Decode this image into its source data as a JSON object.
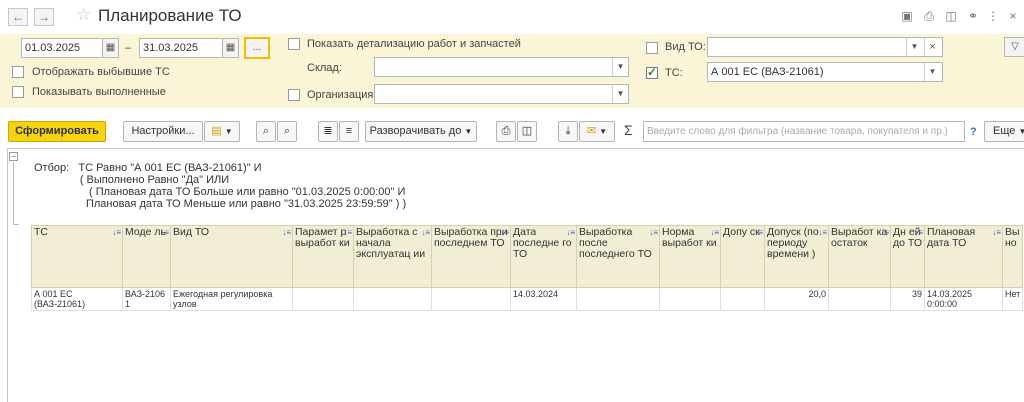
{
  "window": {
    "title": "Планирование ТО"
  },
  "filters": {
    "date_from": "01.03.2025",
    "date_sep": "–",
    "date_to": "31.03.2025",
    "period_button": "...",
    "show_retired_label": "Отображать выбывшие ТС",
    "show_completed_label": "Показывать выполненные",
    "show_details_label": "Показать детализацию работ и запчастей",
    "warehouse_label": "Склад:",
    "warehouse_value": "",
    "organization_label": "Организация:",
    "organization_value": "",
    "to_type_label": "Вид ТО:",
    "to_type_value": "",
    "clear_glyph": "×",
    "vehicle_label": "ТС:",
    "vehicle_value": "А 001 ЕС (ВАЗ-21061)"
  },
  "toolbar": {
    "generate": "Сформировать",
    "settings": "Настройки...",
    "expand_to": "Разворачивать до",
    "sigma": "Σ",
    "search_placeholder": "Введите слово для фильтра (название товара, покупателя и пр.)",
    "help": "?",
    "more": "Еще"
  },
  "report": {
    "filter_lines": [
      "Отбор:   ТС Равно \"А 001 ЕС (ВАЗ-21061)\" И",
      "               ( Выполнено Равно \"Да\" ИЛИ",
      "                  ( Плановая дата ТО Больше или равно \"01.03.2025 0:00:00\" И",
      "                 Плановая дата ТО Меньше или равно \"31.03.2025 23:59:59\" ) )"
    ],
    "columns": [
      "ТС",
      "Моде ль",
      "Вид ТО",
      "Парамет р выработ ки",
      "Выработка с начала эксплуатац ии",
      "Выработка при последнем ТО",
      "Дата последне го ТО",
      "Выработка после последнего ТО",
      "Норма выработ ки",
      "Допу ск",
      "Допуск (по периоду времени )",
      "Выработ ка остаток",
      "Дн ей до ТО",
      "Плановая дата ТО",
      "Вы но"
    ],
    "rows": [
      {
        "ts": "А 001 ЕС (ВАЗ-21061)",
        "model": "ВАЗ-2106 1",
        "to_type": "Ежегодная регулировка узлов",
        "param": "",
        "since_start": "",
        "at_last": "",
        "last_date": "14.03.2024",
        "after_last": "",
        "norm": "",
        "tolerance": "",
        "tolerance_period": "20,0",
        "remaining": "",
        "days_to": "39",
        "planned_date": "14.03.2025 0:00:00",
        "done": "Нет"
      }
    ]
  }
}
